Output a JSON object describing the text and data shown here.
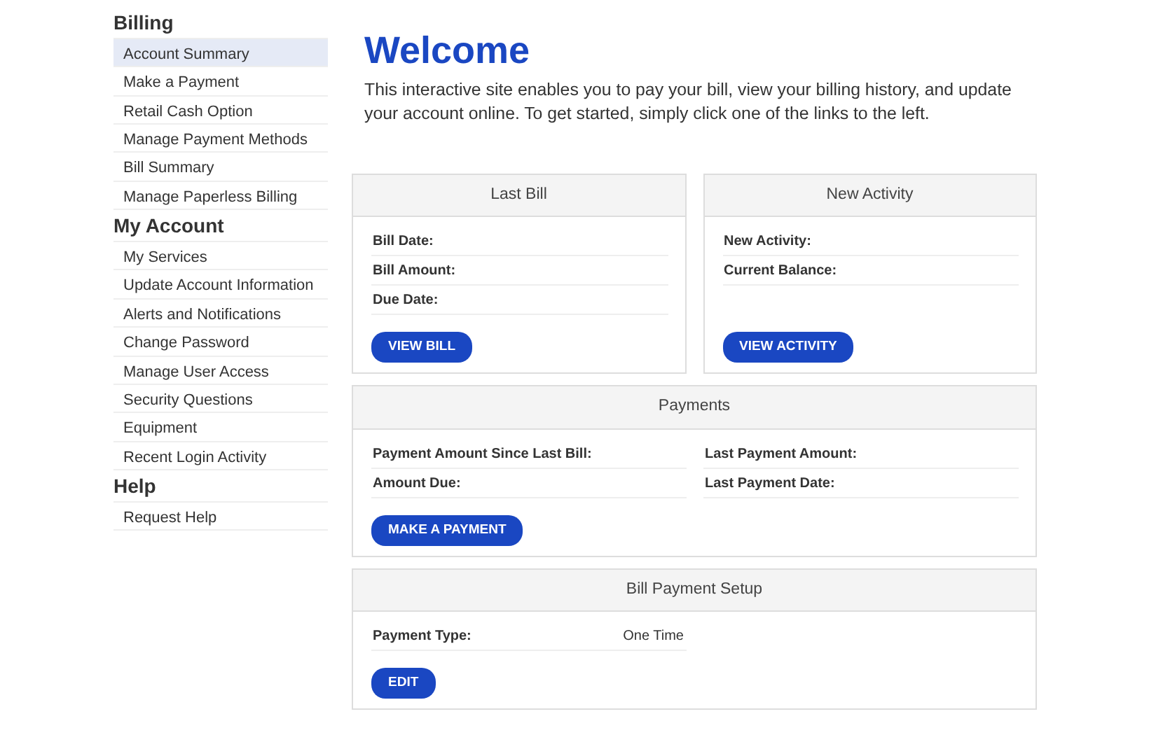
{
  "sidebar": {
    "sections": [
      {
        "heading": "Billing",
        "items": [
          {
            "label": "Account Summary",
            "selected": true
          },
          {
            "label": "Make a Payment",
            "selected": false
          },
          {
            "label": "Retail Cash Option",
            "selected": false
          },
          {
            "label": "Manage Payment Methods",
            "selected": false
          },
          {
            "label": "Bill Summary",
            "selected": false
          },
          {
            "label": "Manage Paperless Billing",
            "selected": false
          }
        ]
      },
      {
        "heading": "My Account",
        "items": [
          {
            "label": "My Services",
            "selected": false
          },
          {
            "label": "Update Account Information",
            "selected": false
          },
          {
            "label": "Alerts and Notifications",
            "selected": false
          },
          {
            "label": "Change Password",
            "selected": false
          },
          {
            "label": "Manage User Access",
            "selected": false
          },
          {
            "label": "Security Questions",
            "selected": false
          },
          {
            "label": "Equipment",
            "selected": false
          },
          {
            "label": "Recent Login Activity",
            "selected": false
          }
        ]
      },
      {
        "heading": "Help",
        "items": [
          {
            "label": "Request Help",
            "selected": false
          }
        ]
      }
    ]
  },
  "welcome": {
    "title": "Welcome",
    "text": "This interactive site enables you to pay your bill, view your billing history, and update your account online. To get started, simply click one of the links to the left."
  },
  "panel_rows": [
    [
      {
        "title": "Last Bill",
        "columns": [
          [
            {
              "label": "Bill Date:"
            },
            {
              "label": "Bill Amount:"
            },
            {
              "label": "Due Date:"
            }
          ]
        ],
        "button": "VIEW BILL"
      },
      {
        "title": "New Activity",
        "columns": [
          [
            {
              "label": "New Activity:"
            },
            {
              "label": "Current Balance:"
            }
          ]
        ],
        "button": "VIEW ACTIVITY"
      }
    ],
    [
      {
        "title": "Payments",
        "columns": [
          [
            {
              "label": "Payment Amount Since Last Bill:"
            },
            {
              "label": "Amount Due:"
            }
          ],
          [
            {
              "label": "Last Payment Amount:"
            },
            {
              "label": "Last Payment Date:"
            }
          ]
        ],
        "button": "MAKE A PAYMENT"
      }
    ],
    [
      {
        "title": "Bill Payment Setup",
        "columns": [
          [
            {
              "label": "Payment Type:",
              "value": "One Time"
            }
          ]
        ],
        "button": "EDIT"
      }
    ]
  ]
}
